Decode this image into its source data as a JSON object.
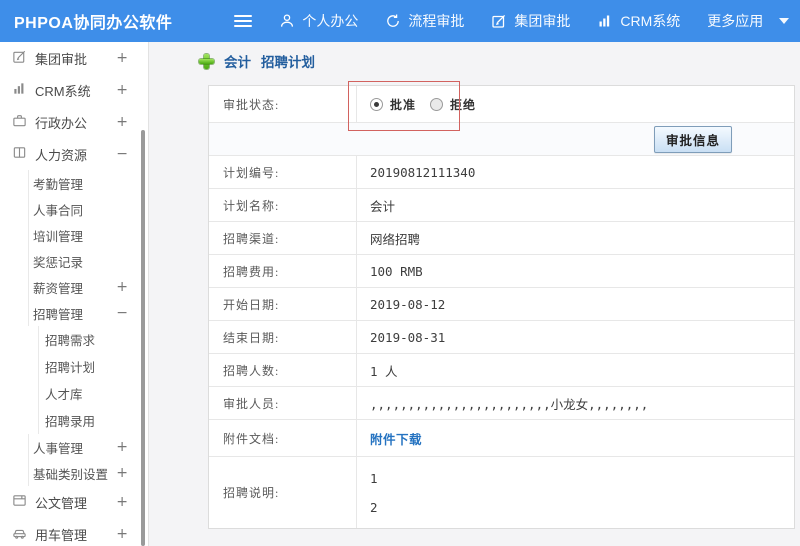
{
  "topbar": {
    "title": "PHPOA协同办公软件",
    "nav": [
      {
        "label": "个人办公",
        "icon": "user-icon"
      },
      {
        "label": "流程审批",
        "icon": "history-icon"
      },
      {
        "label": "集团审批",
        "icon": "edit-square-icon"
      },
      {
        "label": "CRM系统",
        "icon": "bar-chart-icon"
      },
      {
        "label": "更多应用",
        "icon": "caret-down-icon"
      }
    ]
  },
  "sidebar": {
    "items": [
      {
        "label": "集团审批",
        "level": 0,
        "icon": "edit-square-icon",
        "expand": "+"
      },
      {
        "label": "CRM系统",
        "level": 0,
        "icon": "bar-chart-icon",
        "expand": "+"
      },
      {
        "label": "行政办公",
        "level": 0,
        "icon": "briefcase-icon",
        "expand": "+"
      },
      {
        "label": "人力资源",
        "level": 0,
        "icon": "book-icon",
        "expand": "−"
      },
      {
        "label": "考勤管理",
        "level": 1,
        "expand": ""
      },
      {
        "label": "人事合同",
        "level": 1,
        "expand": ""
      },
      {
        "label": "培训管理",
        "level": 1,
        "expand": ""
      },
      {
        "label": "奖惩记录",
        "level": 1,
        "expand": ""
      },
      {
        "label": "薪资管理",
        "level": 1,
        "expand": "+"
      },
      {
        "label": "招聘管理",
        "level": 1,
        "expand": "−"
      },
      {
        "label": "招聘需求",
        "level": 2,
        "expand": ""
      },
      {
        "label": "招聘计划",
        "level": 2,
        "expand": ""
      },
      {
        "label": "人才库",
        "level": 2,
        "expand": ""
      },
      {
        "label": "招聘录用",
        "level": 2,
        "expand": ""
      },
      {
        "label": "人事管理",
        "level": 1,
        "expand": "+"
      },
      {
        "label": "基础类别设置",
        "level": 1,
        "expand": "+"
      },
      {
        "label": "公文管理",
        "level": 0,
        "icon": "document-icon",
        "expand": "+"
      },
      {
        "label": "用车管理",
        "level": 0,
        "icon": "car-icon",
        "expand": "+"
      }
    ]
  },
  "breadcrumb": {
    "plan_name": "会计",
    "page_name": "招聘计划"
  },
  "form": {
    "status_label": "审批状态:",
    "radio_approve": "批准",
    "radio_reject": "拒绝",
    "approve_button": "审批信息",
    "rows": [
      {
        "label": "计划编号:",
        "value": "20190812111340"
      },
      {
        "label": "计划名称:",
        "value": "会计"
      },
      {
        "label": "招聘渠道:",
        "value": "网络招聘"
      },
      {
        "label": "招聘费用:",
        "value": "100 RMB"
      },
      {
        "label": "开始日期:",
        "value": "2019-08-12"
      },
      {
        "label": "结束日期:",
        "value": "2019-08-31"
      },
      {
        "label": "招聘人数:",
        "value": "1 人"
      },
      {
        "label": "审批人员:",
        "value": ",,,,,,,,,,,,,,,,,,,,,,,,小龙女,,,,,,,,"
      },
      {
        "label": "附件文档:",
        "value": "附件下载"
      },
      {
        "label": "招聘说明:",
        "line1": "1",
        "line2": "2"
      }
    ]
  },
  "colors": {
    "topbar_bg": "#3e8ee9",
    "content_bg": "#f4f4f6",
    "breadcrumb_text": "#235e9e",
    "link_blue": "#2573c1",
    "highlight_red": "#d2625f",
    "plus_green": "#55b31c"
  }
}
